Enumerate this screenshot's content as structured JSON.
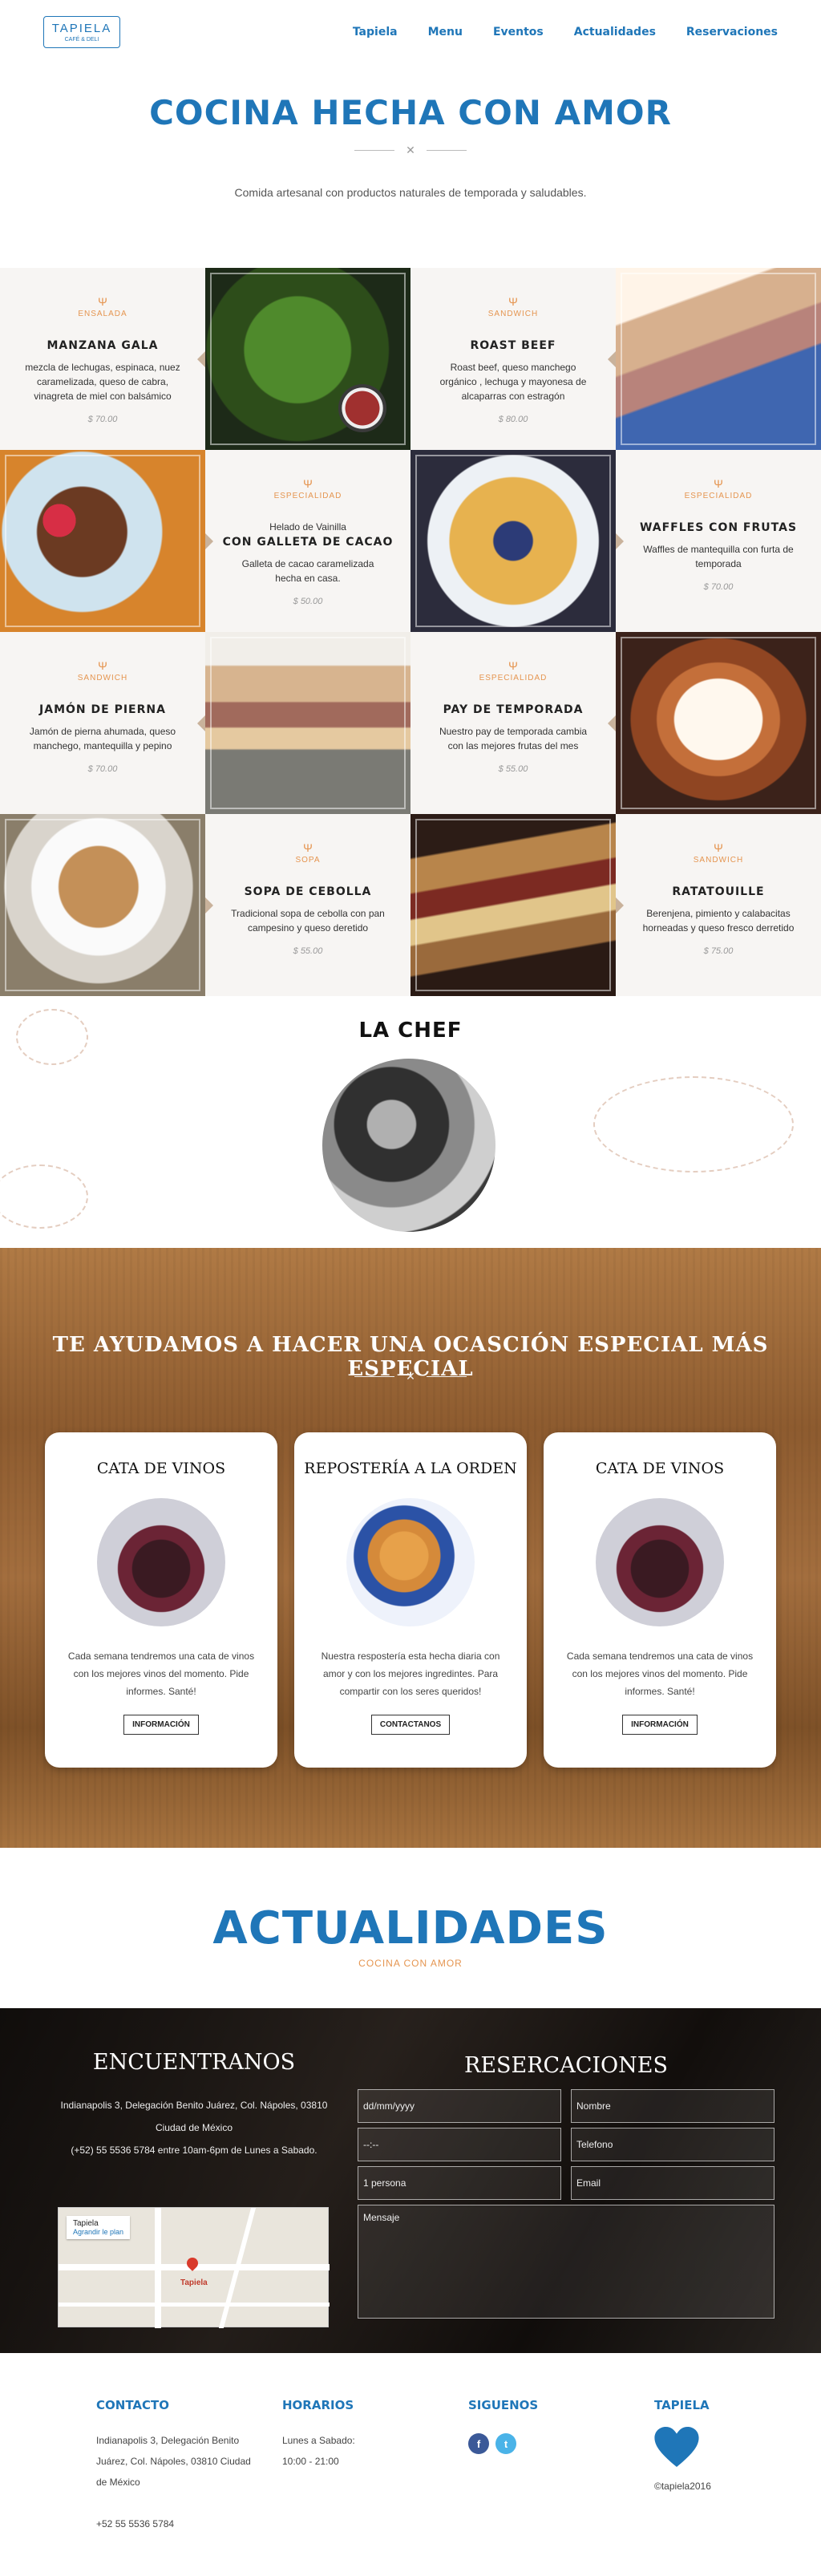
{
  "brand": {
    "logo_line1": "TAPIELA",
    "logo_line2": "CAFÉ & DELI",
    "primary_color": "#1f76b8",
    "accent_color": "#e59550"
  },
  "nav": {
    "items": [
      "Tapiela",
      "Menu",
      "Eventos",
      "Actualidades",
      "Reservaciones"
    ]
  },
  "hero": {
    "title": "COCINA HECHA CON AMOR",
    "divider_glyph": "✕",
    "subtitle": "Comida artesanal con productos naturales de temporada y saludables."
  },
  "menu_cards": [
    {
      "category": "ENSALADA",
      "name": "MANZANA GALA",
      "pre": "",
      "desc": "mezcla de lechugas, espinaca, nuez caramelizada, queso de cabra, vinagreta de miel con balsámico",
      "price": "$ 70.00"
    },
    {
      "category": "SANDWICH",
      "name": "ROAST BEEF",
      "pre": "",
      "desc": "Roast beef, queso manchego orgánico , lechuga y mayonesa de alcaparras con estragón",
      "price": "$ 80.00"
    },
    {
      "category": "ESPECIALIDAD",
      "name": "CON GALLETA DE CACAO",
      "pre": "Helado de Vainilla",
      "desc": "Galleta de cacao caramelizada hecha en casa.",
      "price": "$ 50.00"
    },
    {
      "category": "ESPECIALIDAD",
      "name": "WAFFLES CON FRUTAS",
      "pre": "",
      "desc": "Waffles de mantequilla con furta de temporada",
      "price": "$ 70.00"
    },
    {
      "category": "SANDWICH",
      "name": "JAMÓN DE PIERNA",
      "pre": "",
      "desc": "Jamón de pierna ahumada, queso manchego, mantequilla y pepino",
      "price": "$ 70.00"
    },
    {
      "category": "ESPECIALIDAD",
      "name": "PAY DE TEMPORADA",
      "pre": "",
      "desc": "Nuestro pay de temporada cambia con las mejores frutas del mes",
      "price": "$ 55.00"
    },
    {
      "category": "SOPA",
      "name": "SOPA DE CEBOLLA",
      "pre": "",
      "desc": "Tradicional sopa de cebolla con pan campesino y queso deretido",
      "price": "$ 55.00"
    },
    {
      "category": "SANDWICH",
      "name": "RATATOUILLE",
      "pre": "",
      "desc": "Berenjena, pimiento y calabacitas horneadas y queso fresco derretido",
      "price": "$ 75.00"
    }
  ],
  "chef": {
    "title": "LA CHEF"
  },
  "services": {
    "title": "TE AYUDAMOS A HACER UNA OCASCIÓN ESPECIAL MÁS ESPECIAL",
    "cards": [
      {
        "title": "CATA DE VINOS",
        "text": "Cada semana tendremos una cata de vinos con los mejores vinos del momento. Pide informes. Santé!",
        "button": "INFORMACIÓN"
      },
      {
        "title": "REPOSTERÍA A LA ORDEN",
        "text": "Nuestra respostería esta hecha diaria con amor y con los mejores ingredintes. Para compartir con los seres queridos!",
        "button": "CONTACTANOS"
      },
      {
        "title": "CATA DE VINOS",
        "text": "Cada semana tendremos una cata de vinos con los mejores vinos del momento. Pide informes. Santé!",
        "button": "INFORMACIÓN"
      }
    ]
  },
  "actualidades": {
    "title": "ACTUALIDADES",
    "subtitle": "COCINA CON AMOR"
  },
  "encuentranos": {
    "title": "ENCUENTRANOS",
    "address": "Indianapolis 3, Delegación Benito Juárez, Col. Nápoles, 03810 Ciudad de México",
    "phone_hours": "(+52) 55 5536 5784 entre 10am-6pm de Lunes a Sabado.",
    "map": {
      "place": "Tapiela",
      "link": "Agrandir le plan",
      "pin_label": "Tapiela"
    }
  },
  "reservaciones": {
    "title": "RESERCACIONES",
    "fields": {
      "date": "dd/mm/yyyy",
      "name": "Nombre",
      "time": "--:--",
      "phone": "Telefono",
      "people": "1 persona",
      "email": "Email",
      "message": "Mensaje"
    }
  },
  "footer": {
    "contacto": {
      "title": "CONTACTO",
      "address": "Indianapolis 3, Delegación Benito Juárez, Col. Nápoles, 03810 Ciudad de México",
      "phone": "+52 55 5536 5784"
    },
    "horarios": {
      "title": "HORARIOS",
      "days": "Lunes a Sabado:",
      "hours": "10:00 - 21:00"
    },
    "siguenos": {
      "title": "SIGUENOS",
      "facebook_color": "#3b5998",
      "twitter_color": "#4ab3e8"
    },
    "tapiela": {
      "title": "TAPIELA",
      "copyright": "©tapiela2016"
    }
  }
}
